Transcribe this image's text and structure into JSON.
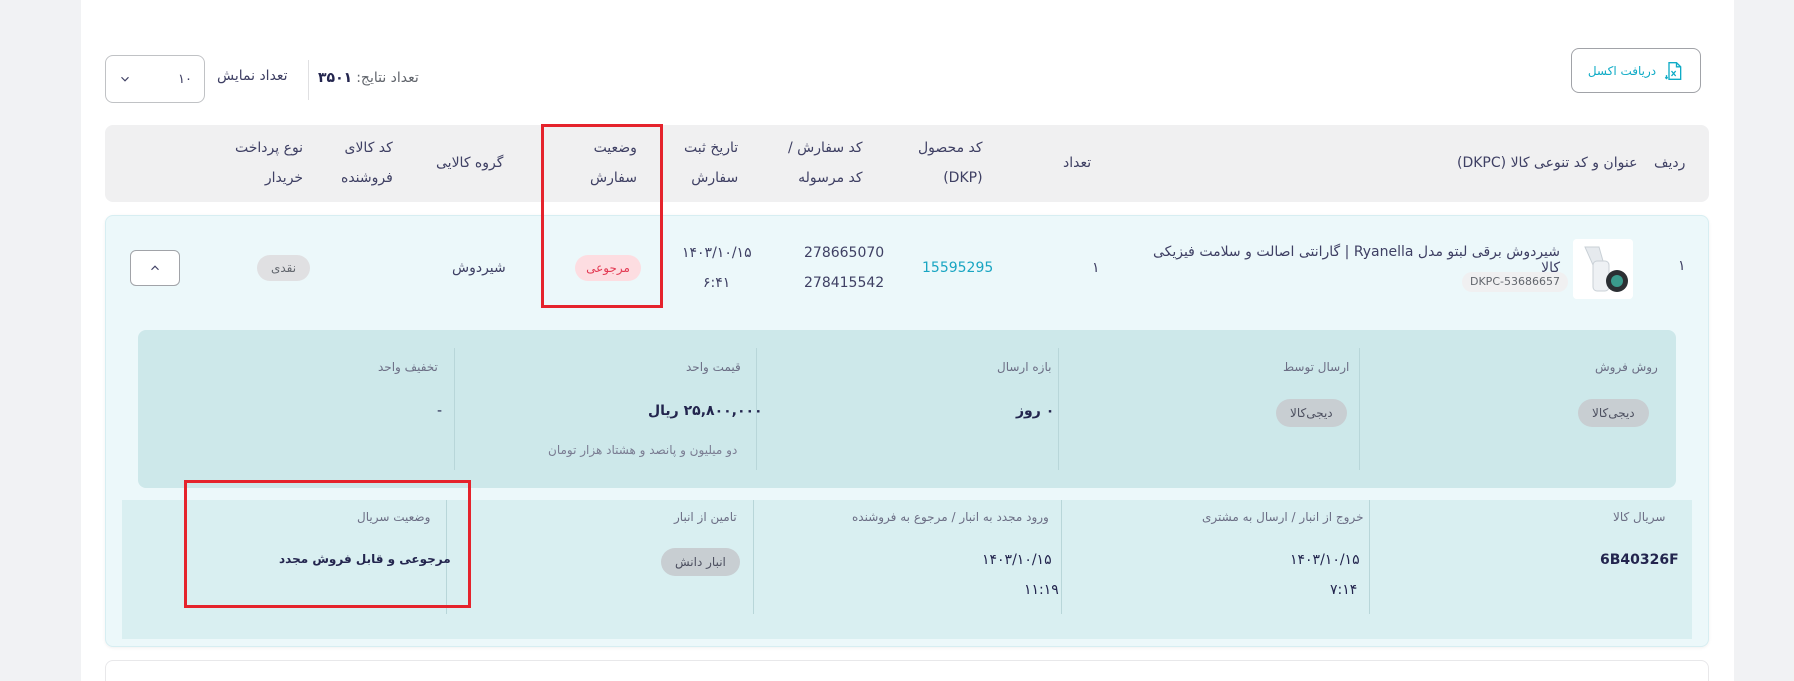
{
  "toolbar": {
    "excel_label": "دریافت اکسل",
    "results_label": "تعداد نتایج:",
    "results_count": "۳۵۰۱",
    "display_label": "تعداد نمایش",
    "display_value": "۱۰"
  },
  "table": {
    "headers": {
      "row": "ردیف",
      "title": "عنوان و کد تنوعی کالا (DKPC)",
      "qty": "تعداد",
      "product_code_1": "کد محصول",
      "product_code_2": "(DKP)",
      "order_code_1": "کد سفارش /",
      "order_code_2": "کد مرسوله",
      "date_1": "تاریخ ثبت",
      "date_2": "سفارش",
      "status_1": "وضعیت",
      "status_2": "سفارش",
      "group": "گروه کالایی",
      "seller_code_1": "کد کالای",
      "seller_code_2": "فروشنده",
      "pay_1": "نوع پرداخت",
      "pay_2": "خریدار"
    },
    "row": {
      "index": "۱",
      "title": "شیردوش برقی لبتو مدل Ryanella | گارانتی اصالت و سلامت فیزیکی کالا",
      "dkpc": "DKPC-53686657",
      "qty": "۱",
      "dkp": "15595295",
      "order_code": "278665070",
      "shipment_code": "278415542",
      "date": "۱۴۰۳/۱۰/۱۵",
      "time": "۶:۴۱",
      "status": "مرجوعی",
      "group": "شیردوش",
      "payment": "نقدی"
    }
  },
  "details": {
    "sale_method_label": "روش فروش",
    "sale_method_value": "دیجی‌کالا",
    "shipped_by_label": "ارسال توسط",
    "shipped_by_value": "دیجی‌کالا",
    "ship_window_label": "بازه ارسال",
    "ship_window_value": "۰ روز",
    "unit_price_label": "قیمت واحد",
    "unit_price_value": "۲۵,۸۰۰,۰۰۰ ریال",
    "unit_price_words": "دو میلیون و پانصد و هشتاد هزار تومان",
    "unit_discount_label": "تخفیف واحد",
    "unit_discount_value": "-",
    "serial_label": "سریال کالا",
    "serial_value": "6B40326F",
    "exit_label": "خروج از انبار / ارسال به مشتری",
    "exit_date": "۱۴۰۳/۱۰/۱۵",
    "exit_time": "۷:۱۴",
    "reentry_label": "ورود مجدد به انبار / مرجوع به فروشنده",
    "reentry_date": "۱۴۰۳/۱۰/۱۵",
    "reentry_time": "۱۱:۱۹",
    "supply_label": "تامین از انبار",
    "supply_value": "انبار دانش",
    "serial_status_label": "وضعیت سریال",
    "serial_status_value": "مرجوعی و قابل فروش مجدد"
  },
  "colors": {
    "accent": "#19a5c2",
    "return_badge_bg": "#fddde1",
    "return_badge_text": "#e33a53",
    "highlight": "#e5232c"
  }
}
